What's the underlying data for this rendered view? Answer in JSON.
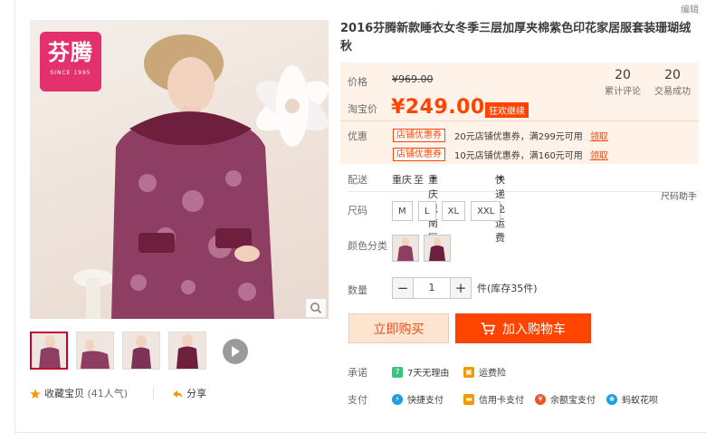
{
  "toolbar": {
    "edit_link": "编辑",
    "size_helper": "尺码助手"
  },
  "gallery": {
    "brand_logo_text": "芬腾",
    "brand_logo_sub": "SINCE 1995",
    "thumbnail_count": 4,
    "zoom_icon": "magnifier-icon",
    "video_icon": "play-icon"
  },
  "actions": {
    "collect_label": "收藏宝贝",
    "collect_count": "(41人气)",
    "share_label": "分享"
  },
  "product": {
    "title": "2016芬腾新款睡衣女冬季三层加厚夹棉紫色印花家居服套装珊瑚绒秋"
  },
  "price": {
    "original_label": "价格",
    "original_value": "¥969.00",
    "taobao_label": "淘宝价",
    "current_value": "¥249.00",
    "promo_badge": "狂欢继续",
    "stats": [
      {
        "num": "20",
        "label": "累计评论"
      },
      {
        "num": "20",
        "label": "交易成功"
      }
    ]
  },
  "coupons": {
    "label": "优惠",
    "items": [
      {
        "tag": "店铺优惠券",
        "desc": "20元店铺优惠券，满299元可用",
        "action": "领取"
      },
      {
        "tag": "店铺优惠券",
        "desc": "10元店铺优惠券，满160元可用",
        "action": "领取"
      }
    ]
  },
  "delivery": {
    "label": "配送",
    "from": "重庆",
    "to_word": "至",
    "destination": "重庆巴南区",
    "method": "快递 免运费"
  },
  "size": {
    "label": "尺码",
    "options": [
      "M",
      "L",
      "XL",
      "XXL"
    ]
  },
  "color": {
    "label": "颜色分类",
    "option_count": 2
  },
  "quantity": {
    "label": "数量",
    "minus": "−",
    "value": "1",
    "plus": "+",
    "stock": "件(库存35件)"
  },
  "buttons": {
    "buy_now": "立即购买",
    "add_to_cart": "加入购物车"
  },
  "promise": {
    "label": "承诺",
    "items": [
      {
        "icon": "seven-day-icon",
        "text": "7天无理由",
        "color": "#3cc27a"
      },
      {
        "icon": "freight-insurance-icon",
        "text": "运费险",
        "color": "#f39800"
      }
    ]
  },
  "payment": {
    "label": "支付",
    "items": [
      {
        "icon": "quick-pay-icon",
        "text": "快捷支付",
        "color": "#1a9de1"
      },
      {
        "icon": "credit-card-icon",
        "text": "信用卡支付",
        "color": "#f39800"
      },
      {
        "icon": "yuebao-icon",
        "text": "余额宝支付",
        "color": "#e8562a"
      },
      {
        "icon": "huabei-icon",
        "text": "蚂蚁花呗",
        "color": "#1a9de1"
      }
    ]
  },
  "colors": {
    "accent": "#ff4400",
    "price_bg": "#fff2e8",
    "thumb_active": "#c3002f"
  }
}
